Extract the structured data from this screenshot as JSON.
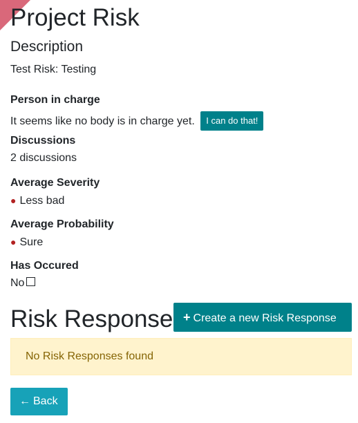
{
  "page": {
    "title": "Project Risk"
  },
  "description": {
    "heading": "Description",
    "text": "Test Risk: Testing"
  },
  "person_in_charge": {
    "label": "Person in charge",
    "value": "It seems like no body is in charge yet.",
    "button_label": "I can do that!"
  },
  "discussions": {
    "label": "Discussions",
    "value": "2 discussions"
  },
  "average_severity": {
    "label": "Average Severity",
    "value": "Less bad"
  },
  "average_probability": {
    "label": "Average Probability",
    "value": "Sure"
  },
  "has_occured": {
    "label": "Has Occured",
    "value": "No"
  },
  "risk_responses": {
    "heading": "Risk Responses",
    "create_label": "Create a new Risk Response",
    "empty_message": "No Risk Responses found"
  },
  "back": {
    "label": "Back"
  },
  "colors": {
    "accent": "#00818a",
    "info": "#17a2b8",
    "warning_bg": "#fff3cd",
    "bullet": "#b22222"
  }
}
